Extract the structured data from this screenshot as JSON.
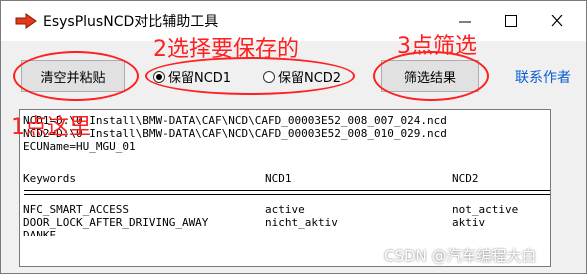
{
  "window": {
    "title": "EsysPlusNCD对比辅助工具",
    "minimize_icon": "minimize-icon",
    "maximize_icon": "maximize-icon",
    "close_icon": "close-icon"
  },
  "toolbar": {
    "clear_paste_label": "清空并粘贴",
    "radio_ncd1_label": "保留NCD1",
    "radio_ncd2_label": "保留NCD2",
    "radio_selected": "NCD1",
    "filter_label": "筛选结果",
    "contact_label": "联系作者"
  },
  "output": {
    "lines": [
      "NCD1=D:\\0-Install\\BMW-DATA\\CAF\\NCD\\CAFD_00003E52_008_007_024.ncd",
      "NCD2=D:\\0-Install\\BMW-DATA\\CAF\\NCD\\CAFD_00003E52_008_010_029.ncd",
      "ECUName=HU_MGU_01"
    ],
    "headers": [
      "Keywords",
      "NCD1",
      "NCD2"
    ],
    "rows": [
      [
        "NFC_SMART_ACCESS",
        "active",
        "not_active"
      ],
      [
        "DOOR_LOCK_AFTER_DRIVING_AWAY",
        "nicht_aktiv",
        "aktiv"
      ]
    ],
    "partial_row": "DANKE"
  },
  "annotations": {
    "step1": "1点这里",
    "step2": "2选择要保存的",
    "step3": "3点筛选",
    "color": "#ff1f1f"
  },
  "watermark": "CSDN @汽车编程大白"
}
